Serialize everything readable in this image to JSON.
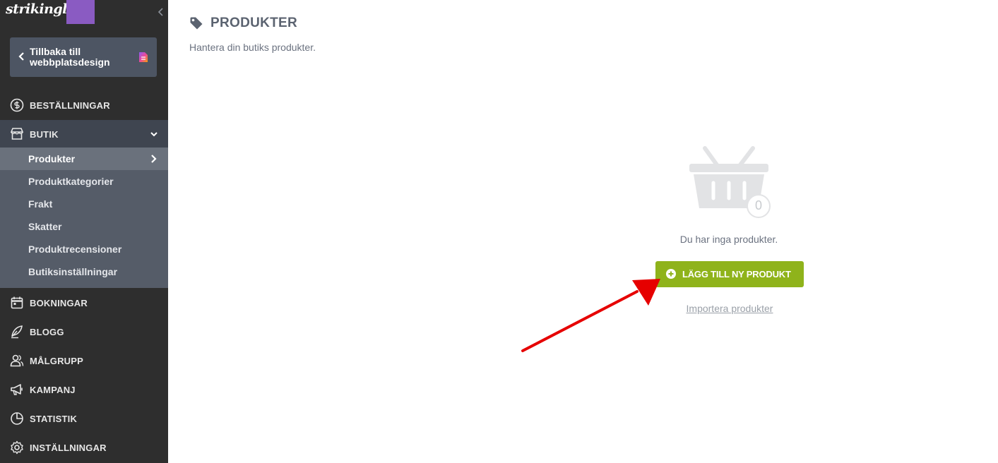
{
  "brand": {
    "logo_text": "strikingly",
    "swatch_color": "#8a5bc2"
  },
  "sidebar": {
    "back_label": "Tillbaka till webbplatsdesign",
    "items": [
      {
        "label": "BESTÄLLNINGAR",
        "icon": "dollar-circle-icon"
      },
      {
        "label": "BUTIK",
        "icon": "store-icon"
      },
      {
        "label": "BOKNINGAR",
        "icon": "calendar-icon"
      },
      {
        "label": "BLOGG",
        "icon": "quill-icon"
      },
      {
        "label": "MÅLGRUPP",
        "icon": "users-icon"
      },
      {
        "label": "KAMPANJ",
        "icon": "megaphone-icon"
      },
      {
        "label": "STATISTIK",
        "icon": "pie-chart-icon"
      },
      {
        "label": "INSTÄLLNINGAR",
        "icon": "gear-icon"
      }
    ],
    "butik_sub": [
      {
        "label": "Produkter"
      },
      {
        "label": "Produktkategorier"
      },
      {
        "label": "Frakt"
      },
      {
        "label": "Skatter"
      },
      {
        "label": "Produktrecensioner"
      },
      {
        "label": "Butiksinställningar"
      }
    ]
  },
  "main": {
    "title": "PRODUKTER",
    "subtitle": "Hantera din butiks produkter.",
    "empty_count": "0",
    "empty_text": "Du har inga produkter.",
    "add_button": "LÄGG TILL NY PRODUKT",
    "import_link": "Importera produkter"
  },
  "colors": {
    "sidebar_bg": "#2e2e2e",
    "accent_green": "#8fb31b",
    "annotation_arrow": "#e60000"
  }
}
